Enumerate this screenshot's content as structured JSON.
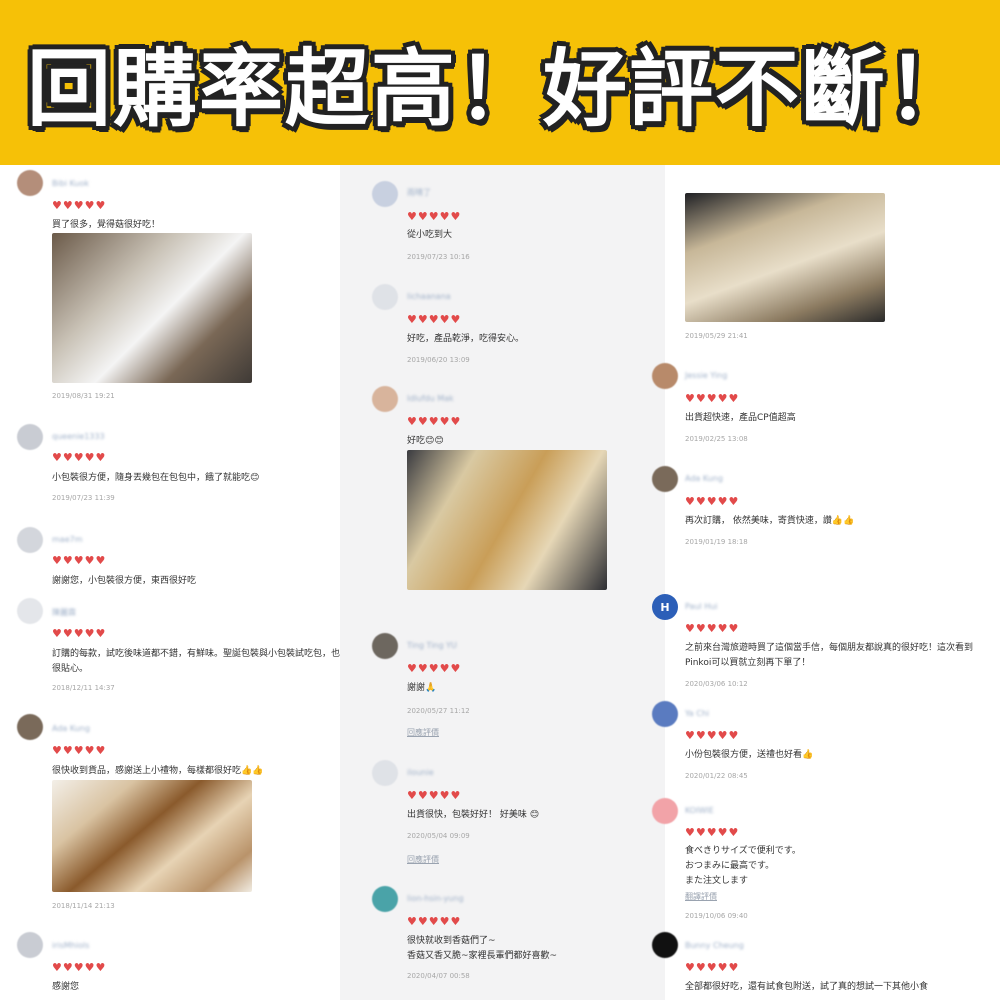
{
  "banner": {
    "title": "回購率超高！好評不斷！"
  },
  "columns": {
    "col1": [
      {
        "name": "Bibi Kuok",
        "hearts": "♥♥♥♥♥",
        "text": "買了很多，覺得菇很好吃！",
        "date": "2019/08/31 19:21",
        "photo": "photo-stacked-snack-boxes"
      },
      {
        "name": "queenie1333",
        "hearts": "♥♥♥♥♥",
        "text": "小包裝很方便，隨身丟幾包在包包中，餓了就能吃😊",
        "date": "2019/07/23 11:39"
      },
      {
        "name": "mae7m",
        "hearts": "♥♥♥♥♥",
        "text": "謝謝您，小包裝很方便，東西很好吃",
        "date": ""
      },
      {
        "name": "陳麗霖",
        "hearts": "♥♥♥♥♥",
        "text": "訂購的每款，試吃後味道都不錯，有鮮味。聖誕包裝與小包裝試吃包，也\n很貼心。",
        "date": "2018/12/11 14:37"
      },
      {
        "name": "Ada Kung",
        "hearts": "♥♥♥♥♥",
        "text": "很快收到貨品，感謝送上小禮物，每樣都很好吃👍👍",
        "date": "2018/11/14 21:13",
        "photo": "photo-gift-packs"
      },
      {
        "name": "irisMhiols",
        "hearts": "♥♥♥♥♥",
        "text": "感謝您",
        "date": ""
      }
    ],
    "col2": [
      {
        "name": "雨晴了",
        "hearts": "♥♥♥♥♥",
        "text": "從小吃到大",
        "date": "2019/07/23 10:16"
      },
      {
        "name": "lichaanana",
        "hearts": "♥♥♥♥♥",
        "text": "好吃，產品乾淨，吃得安心。",
        "date": "2019/06/20 13:09"
      },
      {
        "name": "Idlufdu Mak",
        "hearts": "♥♥♥♥♥",
        "text": "好吃😊😊",
        "date": "",
        "photo": "photo-cheese-snack-box"
      },
      {
        "name": "Ting Ting YU",
        "hearts": "♥♥♥♥♥",
        "text": "謝謝🙏",
        "date": "2020/05/27 11:12",
        "link": "回應評價"
      },
      {
        "name": "ilounie",
        "hearts": "♥♥♥♥♥",
        "text": "出貨很快，包裝好好！ 好美味 😊",
        "date": "2020/05/04 09:09",
        "link": "回應評價"
      },
      {
        "name": "lion-hsin-yung",
        "hearts": "♥♥♥♥♥",
        "text": "很快就收到香菇們了~\n香菇又香又脆~家裡長輩們都好喜歡~",
        "date": "2020/04/07 00:58"
      }
    ],
    "col3": [
      {
        "name": "",
        "hearts": "",
        "text": "",
        "date": "2019/05/29 21:41",
        "photo": "photo-strips-packs"
      },
      {
        "name": "Jessie Ying",
        "hearts": "♥♥♥♥♥",
        "text": "出貨超快速，產品CP值超高",
        "date": "2019/02/25 13:08"
      },
      {
        "name": "Ada Kung",
        "hearts": "♥♥♥♥♥",
        "text": "再次訂購， 依然美味，寄貨快速，讚👍👍",
        "date": "2019/01/19 18:18"
      },
      {
        "name": "Paul Hui",
        "hearts": "♥♥♥♥♥",
        "text": "之前來台灣旅遊時買了這個當手信，每個朋友都說真的很好吃！這次看到\nPinkoi可以買就立刻再下單了！",
        "date": "2020/03/06 10:12",
        "avatar_letter": "H"
      },
      {
        "name": "Ya Chi",
        "hearts": "♥♥♥♥♥",
        "text": "小份包裝很方便，送禮也好看👍",
        "date": "2020/01/22 08:45"
      },
      {
        "name": "KOIWIE",
        "hearts": "♥♥♥♥♥",
        "text": "食べきりサイズで便利です。\nおつまみに最高です。\nまた注文します",
        "date": "2019/10/06 09:40",
        "link": "翻譯評價"
      },
      {
        "name": "Bunny Cheung",
        "hearts": "♥♥♥♥♥",
        "text": "全部都很好吃，還有試食包附送，試了真的想試一下其他小食",
        "date": ""
      }
    ]
  }
}
